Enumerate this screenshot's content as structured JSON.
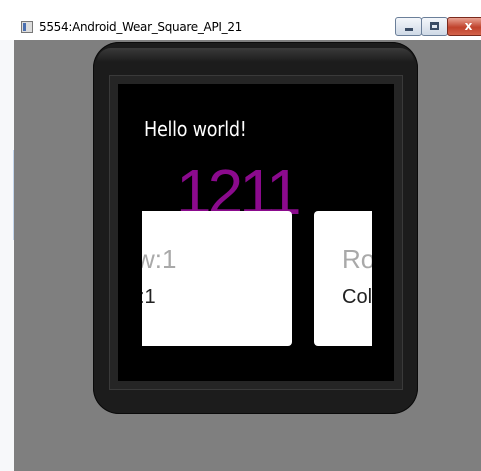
{
  "window": {
    "title": "5554:Android_Wear_Square_API_21",
    "controls": {
      "minimize_icon": "minimize-icon",
      "maximize_icon": "maximize-icon",
      "close_glyph": "x"
    }
  },
  "watch": {
    "hello_text": "Hello world!",
    "counter": "1211",
    "cards": [
      {
        "title": "w:1",
        "text": ":1"
      },
      {
        "title": "Ro",
        "text": "Col"
      }
    ]
  },
  "colors": {
    "counter": "#8b0a8d",
    "emulator_bg": "#7f7f7f",
    "screen_bg": "#000000"
  }
}
